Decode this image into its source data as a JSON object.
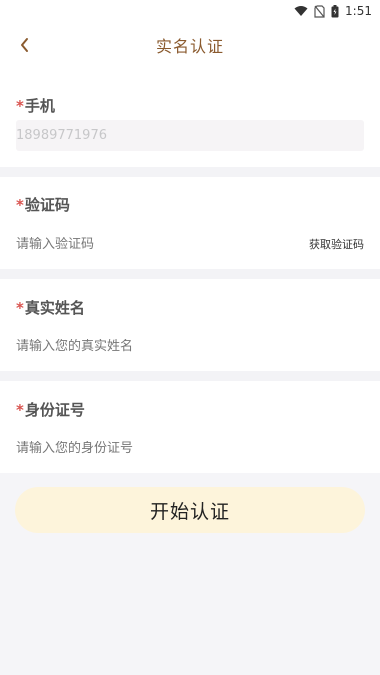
{
  "status_bar": {
    "time": "1:51"
  },
  "header": {
    "title": "实名认证"
  },
  "form": {
    "required_mark": "*",
    "phone": {
      "label": "手机",
      "value": "18989771976"
    },
    "code": {
      "label": "验证码",
      "placeholder": "请输入验证码",
      "button": "获取验证码"
    },
    "name": {
      "label": "真实姓名",
      "placeholder": "请输入您的真实姓名"
    },
    "id_number": {
      "label": "身份证号",
      "placeholder": "请输入您的身份证号"
    }
  },
  "submit": {
    "label": "开始认证"
  },
  "colors": {
    "title": "#8a5a2e",
    "required": "#d9534f",
    "button_bg": "#fdf4db"
  }
}
